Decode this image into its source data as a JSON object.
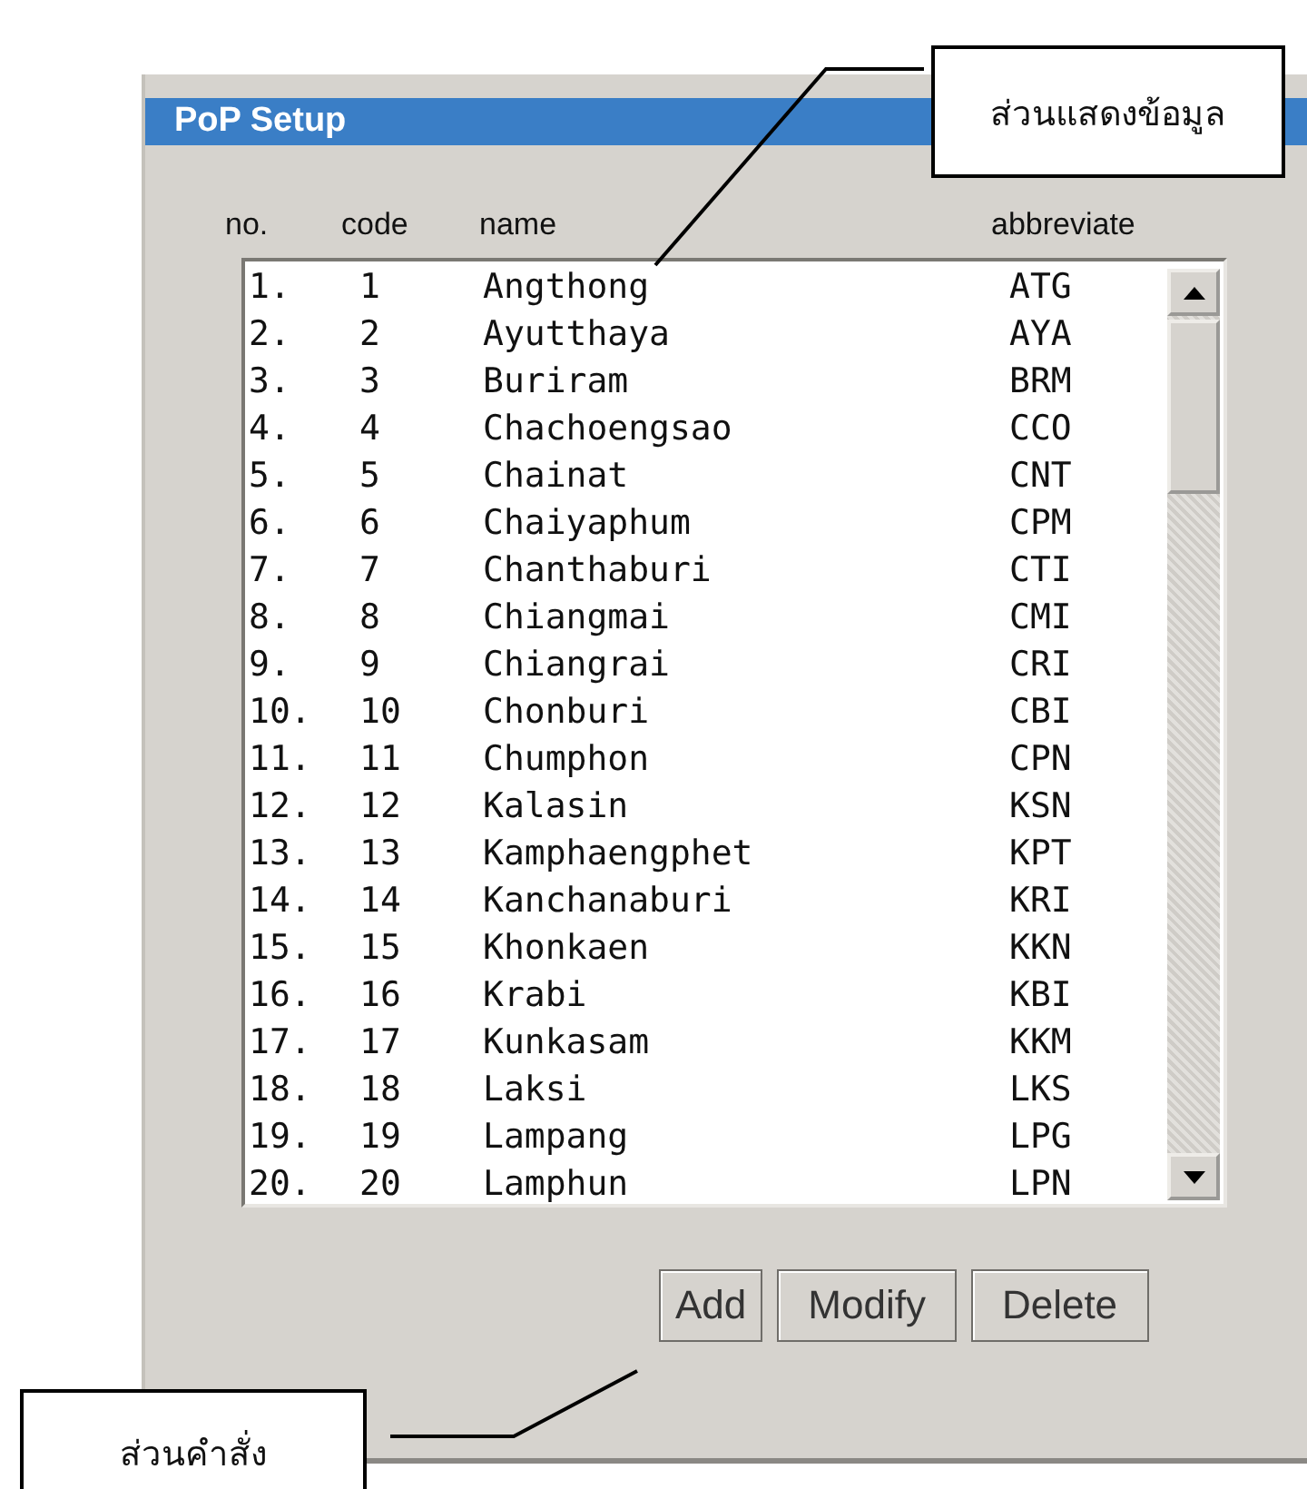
{
  "window": {
    "title": "PoP Setup"
  },
  "columns": [
    "no.",
    "code",
    "name",
    "abbreviate"
  ],
  "rows": [
    {
      "no": "1.",
      "code": "1",
      "name": "Angthong",
      "abbreviate": "ATG"
    },
    {
      "no": "2.",
      "code": "2",
      "name": "Ayutthaya",
      "abbreviate": "AYA"
    },
    {
      "no": "3.",
      "code": "3",
      "name": "Buriram",
      "abbreviate": "BRM"
    },
    {
      "no": "4.",
      "code": "4",
      "name": "Chachoengsao",
      "abbreviate": "CCO"
    },
    {
      "no": "5.",
      "code": "5",
      "name": "Chainat",
      "abbreviate": "CNT"
    },
    {
      "no": "6.",
      "code": "6",
      "name": "Chaiyaphum",
      "abbreviate": "CPM"
    },
    {
      "no": "7.",
      "code": "7",
      "name": "Chanthaburi",
      "abbreviate": "CTI"
    },
    {
      "no": "8.",
      "code": "8",
      "name": "Chiangmai",
      "abbreviate": "CMI"
    },
    {
      "no": "9.",
      "code": "9",
      "name": "Chiangrai",
      "abbreviate": "CRI"
    },
    {
      "no": "10.",
      "code": "10",
      "name": "Chonburi",
      "abbreviate": "CBI"
    },
    {
      "no": "11.",
      "code": "11",
      "name": "Chumphon",
      "abbreviate": "CPN"
    },
    {
      "no": "12.",
      "code": "12",
      "name": "Kalasin",
      "abbreviate": "KSN"
    },
    {
      "no": "13.",
      "code": "13",
      "name": "Kamphaengphet",
      "abbreviate": "KPT"
    },
    {
      "no": "14.",
      "code": "14",
      "name": "Kanchanaburi",
      "abbreviate": "KRI"
    },
    {
      "no": "15.",
      "code": "15",
      "name": "Khonkaen",
      "abbreviate": "KKN"
    },
    {
      "no": "16.",
      "code": "16",
      "name": "Krabi",
      "abbreviate": "KBI"
    },
    {
      "no": "17.",
      "code": "17",
      "name": "Kunkasam",
      "abbreviate": "KKM"
    },
    {
      "no": "18.",
      "code": "18",
      "name": "Laksi",
      "abbreviate": "LKS"
    },
    {
      "no": "19.",
      "code": "19",
      "name": "Lampang",
      "abbreviate": "LPG"
    },
    {
      "no": "20.",
      "code": "20",
      "name": "Lamphun",
      "abbreviate": "LPN"
    }
  ],
  "buttons": [
    "Add",
    "Modify",
    "Delete"
  ],
  "callouts": [
    {
      "text": "ส่วนแสดงข้อมูล"
    },
    {
      "text": "ส่วนคำสั่ง"
    }
  ]
}
